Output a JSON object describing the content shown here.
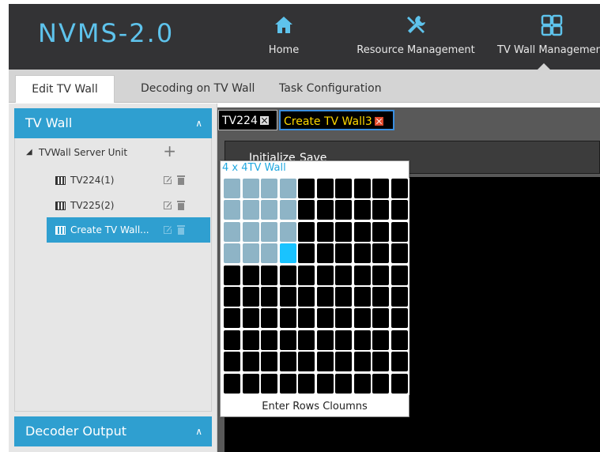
{
  "app": {
    "logo_text": "NVMS-2.0",
    "nav": [
      {
        "label": "Home",
        "icon": "home-icon"
      },
      {
        "label": "Resource Management",
        "icon": "tools-icon"
      },
      {
        "label": "TV Wall Management",
        "icon": "tv-wall-icon"
      }
    ],
    "accent_color": "#2f9fd0",
    "logo_color": "#5ec3ec"
  },
  "subtabs": [
    {
      "label": "Edit TV Wall",
      "active": true
    },
    {
      "label": "Decoding on TV Wall",
      "active": false
    },
    {
      "label": "Task Configuration",
      "active": false
    }
  ],
  "sidebar": {
    "tv_wall_header": "TV Wall",
    "decoder_output_header": "Decoder Output",
    "tree_root": "TVWall Server Unit",
    "items": [
      {
        "label": "TV224(1)",
        "selected": false
      },
      {
        "label": "TV225(2)",
        "selected": false
      },
      {
        "label": "Create TV Wall...",
        "selected": true
      }
    ]
  },
  "doc_tabs": [
    {
      "label": "TV224"
    },
    {
      "label": "Create TV Wall3"
    }
  ],
  "toolbar": {
    "initialize_label": "Initialize",
    "save_label": "Save"
  },
  "grid_popup": {
    "title": "4 x 4TV Wall",
    "footer": "Enter Rows  Cloumns",
    "rows": 10,
    "cols": 10,
    "selected_rows": 4,
    "selected_cols": 4,
    "hover_color": "#19c3ff",
    "selected_color": "#8eb4c6"
  }
}
